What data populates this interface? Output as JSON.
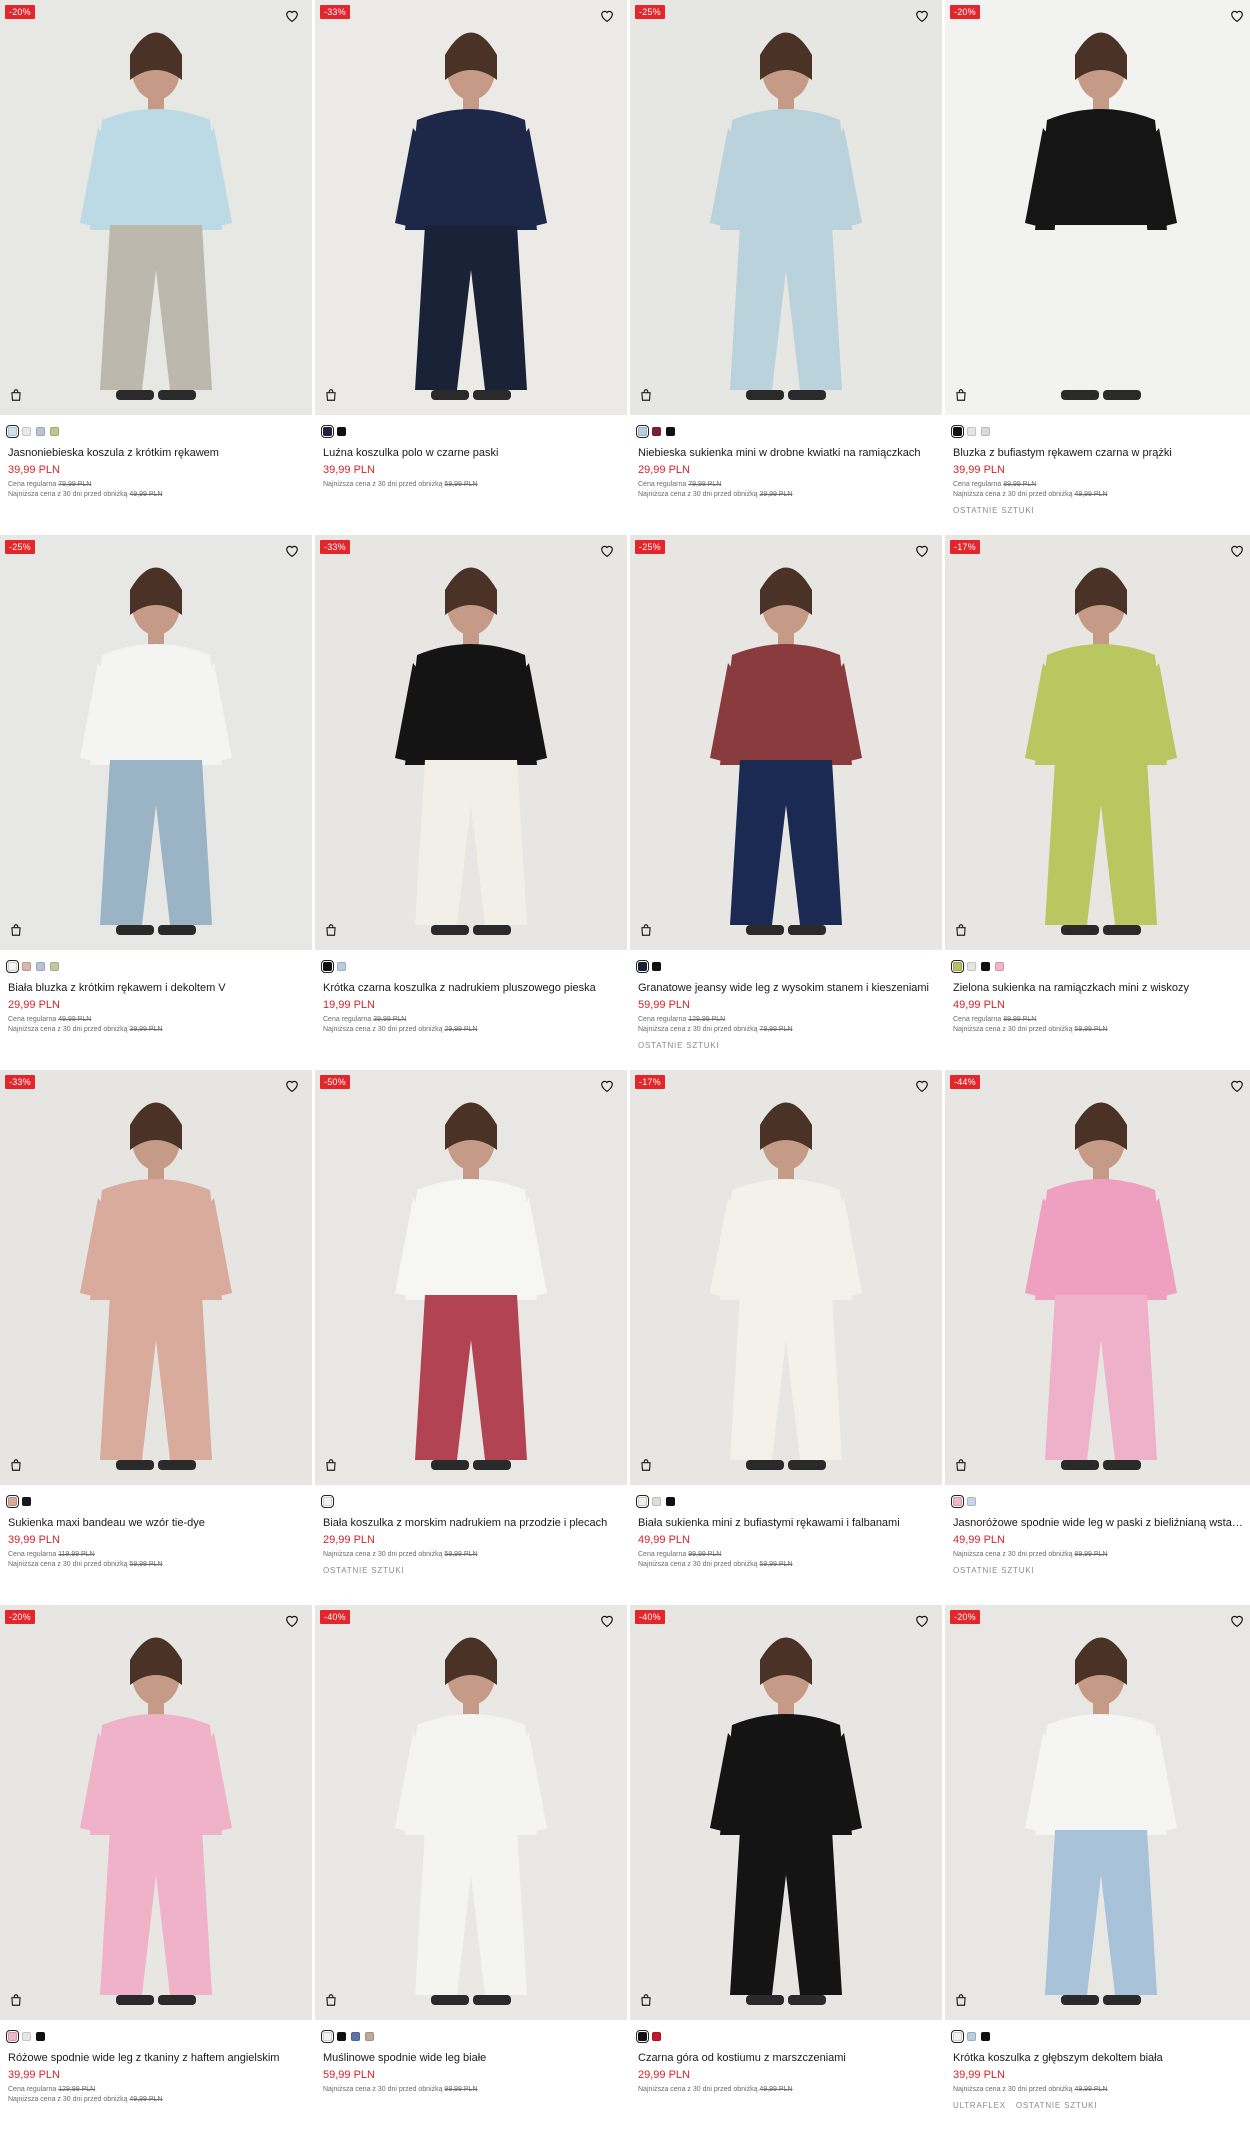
{
  "labels": {
    "regular_price_prefix": "Cena regularna",
    "lowest_price_prefix": "Najniższa cena z 30 dni przed obniżką"
  },
  "colors": {
    "accent_red": "#e3262b",
    "price_red": "#d8232a"
  },
  "icons": {
    "wishlist": "heart-icon",
    "quick_add": "shopping-bag-icon"
  },
  "products": [
    {
      "discount": "-20%",
      "name": "Jasnoniebieska koszula z krótkim rękawem",
      "price": "39,99 PLN",
      "regular": "79,99 PLN",
      "lowest": "49,99 PLN",
      "tags": [],
      "swatches": [
        "#cfe1ec",
        "#e9e9e7",
        "#b9c3d8",
        "#bcc78a"
      ],
      "bg": "#e7e7e4",
      "figure": "#bcd9e6",
      "bottom": "#bdb8ad"
    },
    {
      "discount": "-33%",
      "name": "Luźna koszulka polo w czarne paski",
      "price": "39,99 PLN",
      "regular": "",
      "lowest": "59,99 PLN",
      "tags": [],
      "swatches": [
        "#1c2440",
        "#111111"
      ],
      "bg": "#eceae6",
      "figure": "#1d2748",
      "bottom": "#1a2238"
    },
    {
      "discount": "-25%",
      "name": "Niebieska sukienka mini w drobne kwiatki na ramiączkach",
      "price": "29,99 PLN",
      "regular": "79,99 PLN",
      "lowest": "39,99 PLN",
      "tags": [],
      "swatches": [
        "#b7cfde",
        "#7b2230",
        "#111111"
      ],
      "bg": "#e6e6e3",
      "figure": "#b9d2dc",
      "bottom": "#b9d2dc"
    },
    {
      "discount": "-20%",
      "name": "Bluzka z bufiastym rękawem czarna w prążki",
      "price": "39,99 PLN",
      "regular": "89,99 PLN",
      "lowest": "49,99 PLN",
      "tags": [
        "OSTATNIE SZTUKI"
      ],
      "swatches": [
        "#111111",
        "#e4e4e2",
        "#d7dbe0"
      ],
      "bg": "#f2f2f0",
      "figure": "#151515",
      "bottom": "#f2f2f0"
    },
    {
      "discount": "-25%",
      "name": "Biała bluzka z krótkim rękawem i dekoltem V",
      "price": "29,99 PLN",
      "regular": "49,99 PLN",
      "lowest": "39,99 PLN",
      "tags": [],
      "swatches": [
        "#f3f3f1",
        "#d9b7a9",
        "#b7c4d8",
        "#c2c7a6"
      ],
      "bg": "#e7e7e5",
      "figure": "#f4f4f2",
      "bottom": "#9ab4c6"
    },
    {
      "discount": "-33%",
      "name": "Krótka czarna koszulka z nadrukiem pluszowego pieska",
      "price": "19,99 PLN",
      "regular": "39,99 PLN",
      "lowest": "29,99 PLN",
      "tags": [],
      "swatches": [
        "#111111",
        "#b9cde0"
      ],
      "bg": "#e8e6e2",
      "figure": "#141414",
      "bottom": "#f1efe8"
    },
    {
      "discount": "-25%",
      "name": "Granatowe jeansy wide leg z wysokim stanem i kieszeniami",
      "price": "59,99 PLN",
      "regular": "129,99 PLN",
      "lowest": "79,99 PLN",
      "tags": [
        "OSTATNIE SZTUKI"
      ],
      "swatches": [
        "#15213d",
        "#111111"
      ],
      "bg": "#e7e6e3",
      "figure": "#8a3b3d",
      "bottom": "#1b2a52"
    },
    {
      "discount": "-17%",
      "name": "Zielona sukienka na ramiączkach mini z wiskozy",
      "price": "49,99 PLN",
      "regular": "89,99 PLN",
      "lowest": "59,99 PLN",
      "tags": [],
      "swatches": [
        "#b5c35a",
        "#e5e5e3",
        "#111111",
        "#f0b7c3"
      ],
      "bg": "#e7e6e3",
      "figure": "#b8c760",
      "bottom": "#b8c760"
    },
    {
      "discount": "-33%",
      "name": "Sukienka maxi bandeau we wzór tie-dye",
      "price": "39,99 PLN",
      "regular": "119,99 PLN",
      "lowest": "59,99 PLN",
      "tags": [],
      "swatches": [
        "#d9a99a",
        "#1a1a1a"
      ],
      "bg": "#e7e5e2",
      "figure": "#d8ab9d",
      "bottom": "#d8ab9d"
    },
    {
      "discount": "-50%",
      "name": "Biała koszulka z morskim nadrukiem na przodzie i plecach",
      "price": "29,99 PLN",
      "regular": "",
      "lowest": "59,99 PLN",
      "tags": [
        "OSTATNIE SZTUKI"
      ],
      "swatches": [
        "#f2f2f0"
      ],
      "bg": "#e8e7e4",
      "figure": "#f6f6f4",
      "bottom": "#b14352"
    },
    {
      "discount": "-17%",
      "name": "Biała sukienka mini z bufiastymi rękawami i falbanami",
      "price": "49,99 PLN",
      "regular": "99,99 PLN",
      "lowest": "59,99 PLN",
      "tags": [],
      "swatches": [
        "#f1efe8",
        "#e0ddd5",
        "#111111"
      ],
      "bg": "#e7e6e3",
      "figure": "#f3f1ea",
      "bottom": "#f3f1ea"
    },
    {
      "discount": "-44%",
      "name": "Jasnoróżowe spodnie wide leg w paski z bieliźnianą wstawką",
      "price": "49,99 PLN",
      "regular": "",
      "lowest": "89,99 PLN",
      "tags": [
        "OSTATNIE SZTUKI"
      ],
      "swatches": [
        "#f0b7c9",
        "#c9d3ec"
      ],
      "bg": "#e7e6e3",
      "figure": "#ef9fc0",
      "bottom": "#efb0c9"
    },
    {
      "discount": "-20%",
      "name": "Różowe spodnie wide leg z tkaniny z haftem angielskim",
      "price": "39,99 PLN",
      "regular": "129,99 PLN",
      "lowest": "49,99 PLN",
      "tags": [],
      "swatches": [
        "#f0b7c9",
        "#e5e5e3",
        "#111111"
      ],
      "bg": "#e7e6e3",
      "figure": "#efb2c8",
      "bottom": "#efb2c8"
    },
    {
      "discount": "-40%",
      "name": "Muślinowe spodnie wide leg białe",
      "price": "59,99 PLN",
      "regular": "",
      "lowest": "99,99 PLN",
      "tags": [],
      "swatches": [
        "#f2f2f0",
        "#111111",
        "#5b77a8",
        "#bba99a"
      ],
      "bg": "#e9e8e5",
      "figure": "#f4f4f1",
      "bottom": "#f4f4f1"
    },
    {
      "discount": "-40%",
      "name": "Czarna góra od kostiumu z marszczeniami",
      "price": "29,99 PLN",
      "regular": "",
      "lowest": "49,99 PLN",
      "tags": [],
      "swatches": [
        "#111111",
        "#c0182a"
      ],
      "bg": "#e8e6e3",
      "figure": "#141414",
      "bottom": "#141414"
    },
    {
      "discount": "-20%",
      "name": "Krótka koszulka z głębszym dekoltem biała",
      "price": "39,99 PLN",
      "regular": "",
      "lowest": "49,99 PLN",
      "tags": [
        "ULTRAFLEX",
        "OSTATNIE SZTUKI"
      ],
      "swatches": [
        "#f2f2f0",
        "#b9cde0",
        "#111111"
      ],
      "bg": "#e8e7e4",
      "figure": "#f5f5f3",
      "bottom": "#a8c2da"
    }
  ]
}
